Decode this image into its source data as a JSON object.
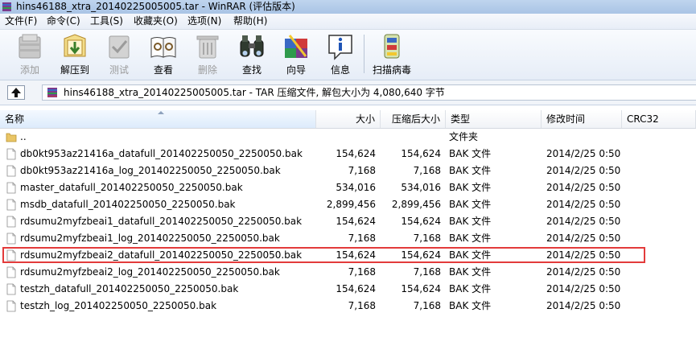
{
  "window": {
    "title": "hins46188_xtra_20140225005005.tar - WinRAR (评估版本)"
  },
  "menu": [
    "文件(F)",
    "命令(C)",
    "工具(S)",
    "收藏夹(O)",
    "选项(N)",
    "帮助(H)"
  ],
  "toolbar": [
    {
      "label": "添加",
      "icon": "add-archive-icon",
      "enabled": false
    },
    {
      "label": "解压到",
      "icon": "extract-to-icon",
      "enabled": true
    },
    {
      "label": "测试",
      "icon": "test-icon",
      "enabled": false
    },
    {
      "label": "查看",
      "icon": "view-icon",
      "enabled": true
    },
    {
      "label": "删除",
      "icon": "delete-icon",
      "enabled": false
    },
    {
      "label": "查找",
      "icon": "find-icon",
      "enabled": true
    },
    {
      "label": "向导",
      "icon": "wizard-icon",
      "enabled": true
    },
    {
      "label": "信息",
      "icon": "info-icon",
      "enabled": true
    },
    {
      "label": "扫描病毒",
      "icon": "virus-scan-icon",
      "enabled": true
    }
  ],
  "address": {
    "path": "hins46188_xtra_20140225005005.tar - TAR 压缩文件, 解包大小为 4,080,640 字节"
  },
  "columns": {
    "name": "名称",
    "size": "大小",
    "packed": "压缩后大小",
    "type": "类型",
    "mtime": "修改时间",
    "crc": "CRC32"
  },
  "rows": [
    {
      "name": "..",
      "size": "",
      "packed": "",
      "type": "文件夹",
      "mtime": "",
      "kind": "folder"
    },
    {
      "name": "db0kt953az21416a_datafull_201402250050_2250050.bak",
      "size": "154,624",
      "packed": "154,624",
      "type": "BAK 文件",
      "mtime": "2014/2/25 0:50",
      "kind": "file"
    },
    {
      "name": "db0kt953az21416a_log_201402250050_2250050.bak",
      "size": "7,168",
      "packed": "7,168",
      "type": "BAK 文件",
      "mtime": "2014/2/25 0:50",
      "kind": "file"
    },
    {
      "name": "master_datafull_201402250050_2250050.bak",
      "size": "534,016",
      "packed": "534,016",
      "type": "BAK 文件",
      "mtime": "2014/2/25 0:50",
      "kind": "file"
    },
    {
      "name": "msdb_datafull_201402250050_2250050.bak",
      "size": "2,899,456",
      "packed": "2,899,456",
      "type": "BAK 文件",
      "mtime": "2014/2/25 0:50",
      "kind": "file"
    },
    {
      "name": "rdsumu2myfzbeai1_datafull_201402250050_2250050.bak",
      "size": "154,624",
      "packed": "154,624",
      "type": "BAK 文件",
      "mtime": "2014/2/25 0:50",
      "kind": "file"
    },
    {
      "name": "rdsumu2myfzbeai1_log_201402250050_2250050.bak",
      "size": "7,168",
      "packed": "7,168",
      "type": "BAK 文件",
      "mtime": "2014/2/25 0:50",
      "kind": "file"
    },
    {
      "name": "rdsumu2myfzbeai2_datafull_201402250050_2250050.bak",
      "size": "154,624",
      "packed": "154,624",
      "type": "BAK 文件",
      "mtime": "2014/2/25 0:50",
      "kind": "file",
      "highlighted": true
    },
    {
      "name": "rdsumu2myfzbeai2_log_201402250050_2250050.bak",
      "size": "7,168",
      "packed": "7,168",
      "type": "BAK 文件",
      "mtime": "2014/2/25 0:50",
      "kind": "file"
    },
    {
      "name": "testzh_datafull_201402250050_2250050.bak",
      "size": "154,624",
      "packed": "154,624",
      "type": "BAK 文件",
      "mtime": "2014/2/25 0:50",
      "kind": "file"
    },
    {
      "name": "testzh_log_201402250050_2250050.bak",
      "size": "7,168",
      "packed": "7,168",
      "type": "BAK 文件",
      "mtime": "2014/2/25 0:50",
      "kind": "file"
    }
  ],
  "colors": {
    "highlight_border": "#e33b3b",
    "folder": "#e9c566"
  }
}
